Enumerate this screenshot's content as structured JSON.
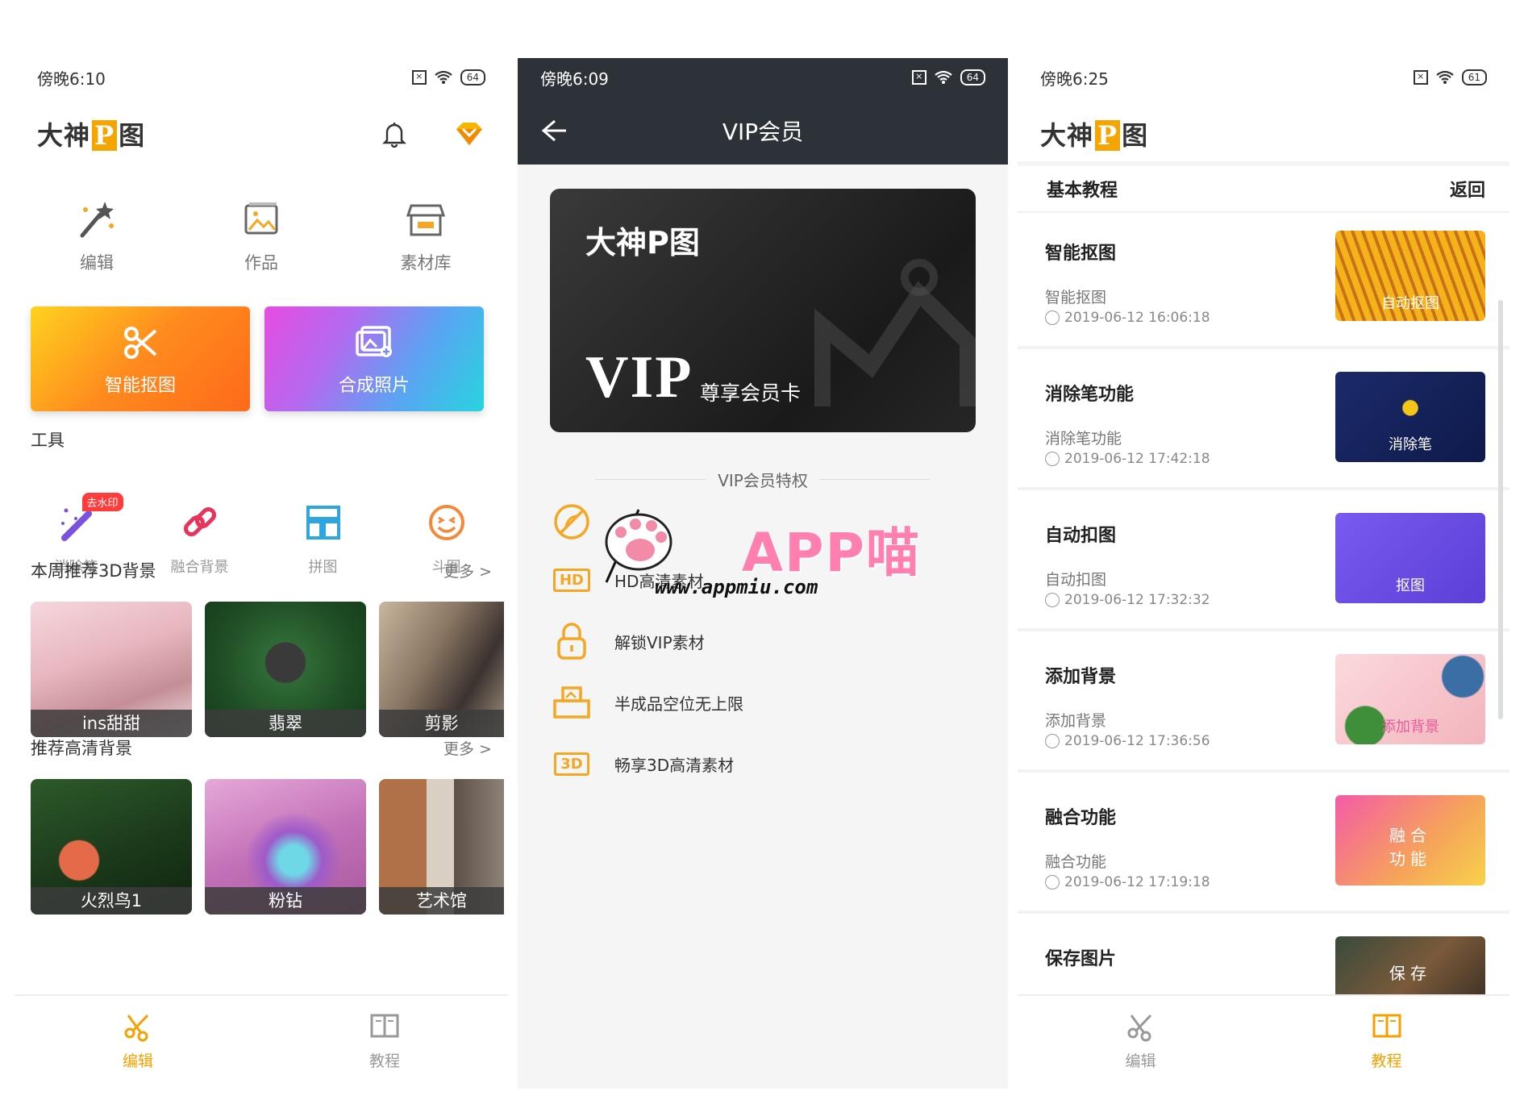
{
  "phone1": {
    "status": {
      "time": "傍晚6:10",
      "battery": "64"
    },
    "brand": {
      "a": "大神",
      "p": "P",
      "b": "图"
    },
    "shortcuts": [
      {
        "label": "编辑",
        "icon": "magic-wand-icon"
      },
      {
        "label": "作品",
        "icon": "picture-icon"
      },
      {
        "label": "素材库",
        "icon": "store-icon"
      }
    ],
    "big_buttons": [
      {
        "label": "智能抠图",
        "icon": "scissors-icon"
      },
      {
        "label": "合成照片",
        "icon": "photo-merge-icon"
      }
    ],
    "tools_title": "工具",
    "tools": [
      {
        "label": "消除笔",
        "badge": "去水印",
        "icon": "eraser-pen-icon"
      },
      {
        "label": "融合背景",
        "icon": "link-icon"
      },
      {
        "label": "拼图",
        "icon": "collage-icon"
      },
      {
        "label": "斗图",
        "icon": "emoji-icon"
      }
    ],
    "section1": {
      "title": "本周推荐3D背景",
      "more": "更多 >"
    },
    "thumbs1": [
      {
        "label": "ins甜甜"
      },
      {
        "label": "翡翠"
      },
      {
        "label": "剪影"
      }
    ],
    "section2": {
      "title": "推荐高清背景",
      "more": "更多 >"
    },
    "thumbs2": [
      {
        "label": "火烈鸟1"
      },
      {
        "label": "粉钻"
      },
      {
        "label": "艺术馆"
      }
    ],
    "tabs": [
      {
        "label": "编辑",
        "active": true
      },
      {
        "label": "教程",
        "active": false
      }
    ]
  },
  "phone2": {
    "status": {
      "time": "傍晚6:09",
      "battery": "64"
    },
    "title": "VIP会员",
    "card": {
      "name": "大神P图",
      "vip": "VIP",
      "subtitle": "尊享会员卡"
    },
    "perks_title": "VIP会员特权",
    "perks": [
      {
        "label": "",
        "icon": "no-ads-icon"
      },
      {
        "label": "HD高清素材",
        "icon": "hd-icon",
        "tag": "HD"
      },
      {
        "label": "解锁VIP素材",
        "icon": "lock-icon"
      },
      {
        "label": "半成品空位无上限",
        "icon": "tray-icon"
      },
      {
        "label": "畅享3D高清素材",
        "icon": "3d-icon",
        "tag": "3D"
      }
    ],
    "watermark": {
      "text": "APP喵",
      "url": "www.appmiu.com"
    }
  },
  "phone3": {
    "status": {
      "time": "傍晚6:25",
      "battery": "61"
    },
    "brand": {
      "a": "大神",
      "p": "P",
      "b": "图"
    },
    "header": {
      "title": "基本教程",
      "back": "返回"
    },
    "tutorials": [
      {
        "title": "智能抠图",
        "sub": "智能抠图",
        "time": "2019-06-12 16:06:18",
        "img_label": "自动抠图"
      },
      {
        "title": "消除笔功能",
        "sub": "消除笔功能",
        "time": "2019-06-12 17:42:18",
        "img_label": "消除笔"
      },
      {
        "title": "自动扣图",
        "sub": "自动扣图",
        "time": "2019-06-12 17:32:32",
        "img_label": "抠图"
      },
      {
        "title": "添加背景",
        "sub": "添加背景",
        "time": "2019-06-12 17:36:56",
        "img_label": "添加背景"
      },
      {
        "title": "融合功能",
        "sub": "融合功能",
        "time": "2019-06-12 17:19:18",
        "img_label": "融合\n功能"
      },
      {
        "title": "保存图片",
        "sub": "",
        "time": "",
        "img_label": "保存"
      }
    ],
    "tabs": [
      {
        "label": "编辑",
        "active": false
      },
      {
        "label": "教程",
        "active": true
      }
    ]
  }
}
